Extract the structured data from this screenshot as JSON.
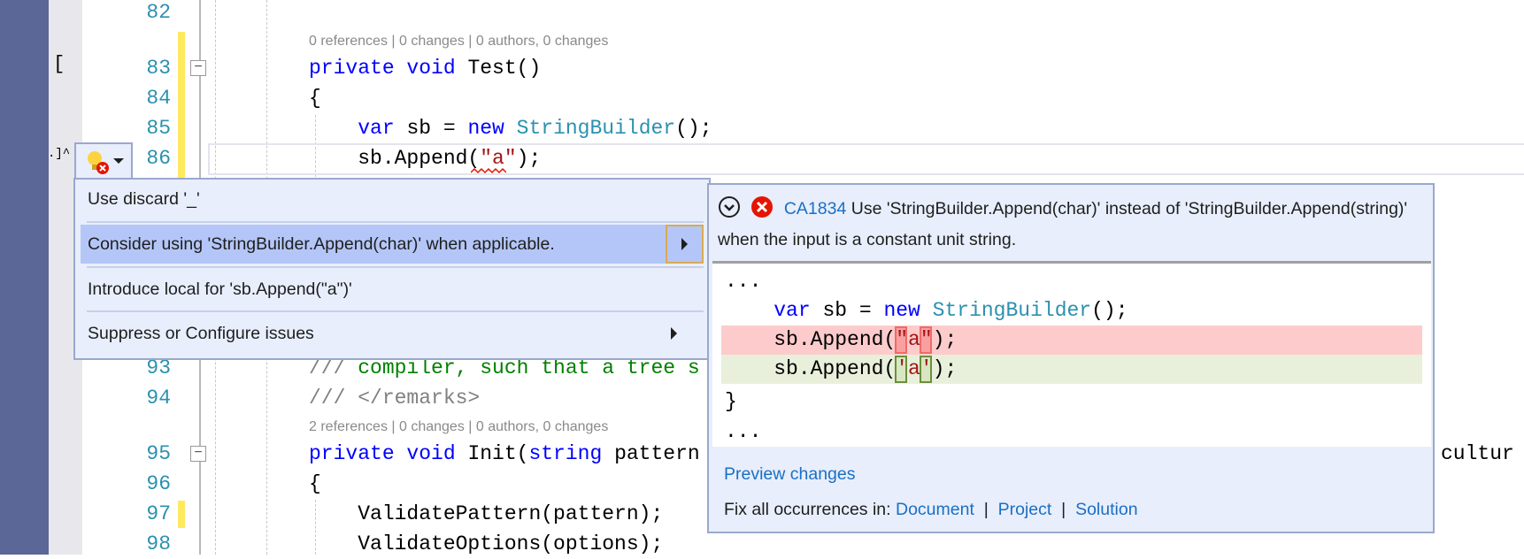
{
  "gutter": {
    "bracket_mark": "[",
    "marker_text": ".]^"
  },
  "editor": {
    "line_numbers": [
      "82",
      "83",
      "84",
      "85",
      "86",
      "93",
      "94",
      "95",
      "96",
      "97",
      "98"
    ],
    "codelens": [
      {
        "refs": "0 references",
        "changes": "0 changes",
        "authors": "0 authors, 0 changes"
      },
      {
        "refs": "2 references",
        "changes": "0 changes",
        "authors": "0 authors, 0 changes"
      }
    ],
    "lines": [
      {
        "num": "83",
        "tokens": [
          [
            "kw",
            "private "
          ],
          [
            "kw",
            "void "
          ],
          [
            "tx",
            "Test"
          ],
          [
            "tx",
            "()"
          ]
        ]
      },
      {
        "num": "84",
        "tokens": [
          [
            "tx",
            "{"
          ]
        ]
      },
      {
        "num": "85",
        "tokens": [
          [
            "tx",
            "    "
          ],
          [
            "kw",
            "var "
          ],
          [
            "tx",
            "sb = "
          ],
          [
            "kw",
            "new "
          ],
          [
            "ty",
            "StringBuilder"
          ],
          [
            "tx",
            "();"
          ]
        ]
      },
      {
        "num": "86",
        "tokens": [
          [
            "tx",
            "    sb.Append("
          ],
          [
            "st",
            "\"a\""
          ],
          [
            "tx",
            ");"
          ]
        ]
      },
      {
        "num": "93",
        "tokens": [
          [
            "cg",
            "/// "
          ],
          [
            "cm",
            "compiler, such that a tree s"
          ]
        ]
      },
      {
        "num": "94",
        "tokens": [
          [
            "cg",
            "/// </remarks>"
          ]
        ]
      },
      {
        "num": "95",
        "tokens": [
          [
            "kw",
            "private "
          ],
          [
            "kw",
            "void "
          ],
          [
            "tx",
            "Init("
          ],
          [
            "kw",
            "string "
          ],
          [
            "tx",
            "pattern"
          ]
        ]
      },
      {
        "num": "96",
        "tokens": [
          [
            "tx",
            "{"
          ]
        ]
      },
      {
        "num": "97",
        "tokens": [
          [
            "tx",
            "    ValidatePattern(pattern);"
          ]
        ]
      },
      {
        "num": "98",
        "tokens": [
          [
            "tx",
            "    ValidateOptions(options);"
          ]
        ]
      }
    ],
    "overflow_text": "cultur"
  },
  "lightbulb": {
    "icon": "lightbulb-error-icon",
    "dropdown_icon": "caret-down-icon"
  },
  "menu": {
    "items": [
      {
        "label": "Use discard '_'",
        "submenu": false,
        "selected": false
      },
      {
        "label": "Consider using 'StringBuilder.Append(char)' when applicable.",
        "submenu": true,
        "selected": true
      },
      {
        "label": "Introduce local for 'sb.Append(\"a\")'",
        "submenu": false,
        "selected": false
      },
      {
        "label": "Suppress or Configure issues",
        "submenu": true,
        "selected": false
      }
    ]
  },
  "preview": {
    "code": "CA1834",
    "message": "Use 'StringBuilder.Append(char)' instead of 'StringBuilder.Append(string)' when the input is a constant unit string.",
    "diff": [
      {
        "kind": "ctx",
        "tokens": [
          [
            "tx",
            "..."
          ]
        ]
      },
      {
        "kind": "ctx",
        "tokens": [
          [
            "tx",
            "    "
          ],
          [
            "kw",
            "var "
          ],
          [
            "tx",
            "sb = "
          ],
          [
            "kw",
            "new "
          ],
          [
            "ty",
            "StringBuilder"
          ],
          [
            "tx",
            "();"
          ]
        ]
      },
      {
        "kind": "del",
        "tokens": [
          [
            "tx",
            "    sb.Append("
          ],
          [
            "st",
            "\"a\""
          ],
          [
            "tx",
            ");"
          ]
        ]
      },
      {
        "kind": "add",
        "tokens": [
          [
            "tx",
            "    sb.Append("
          ],
          [
            "st",
            "'a'"
          ],
          [
            "tx",
            ");"
          ]
        ]
      },
      {
        "kind": "ctx",
        "tokens": [
          [
            "tx",
            "}"
          ]
        ]
      },
      {
        "kind": "ctx",
        "tokens": [
          [
            "tx",
            "..."
          ]
        ]
      }
    ],
    "preview_link": "Preview changes",
    "fix_all_label": "Fix all occurrences in:",
    "scopes": [
      "Document",
      "Project",
      "Solution"
    ],
    "colors": {
      "deleted": "#fdcbcb",
      "added": "#e8f0dc",
      "link": "#1a6fc4",
      "error": "#e51400"
    }
  }
}
